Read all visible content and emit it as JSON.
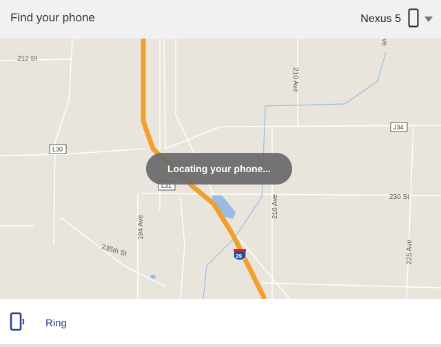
{
  "header": {
    "title": "Find your phone",
    "device_name": "Nexus 5"
  },
  "map": {
    "labels": {
      "st212": "212 St",
      "ave210_top": "210 Ave",
      "j34": "J34",
      "l30": "L30",
      "l31": "L31",
      "st230": "230 St",
      "ave210_bottom": "210 Ave",
      "ave194": "194 Ave",
      "st235": "235th St",
      "i29": "29",
      "ave225": "225 Ave",
      "ave_top": "ve"
    },
    "status": "Locating your phone..."
  },
  "actions": {
    "ring_label": "Ring"
  },
  "colors": {
    "highway": "#f2a02c",
    "water": "#98bce6",
    "road": "#ffffff",
    "accent": "#2b3d8f"
  }
}
